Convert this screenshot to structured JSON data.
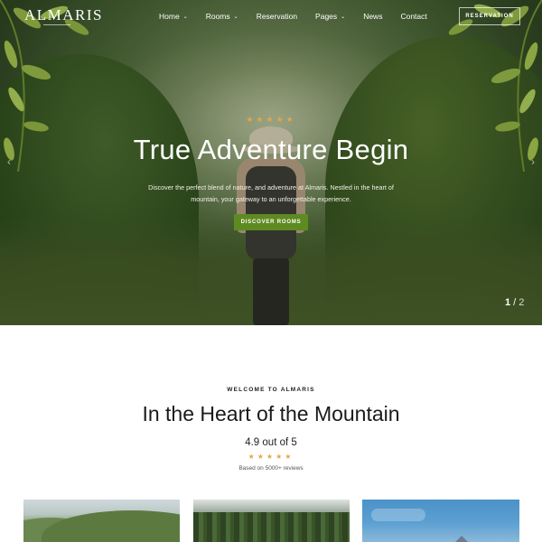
{
  "brand": {
    "name": "ALMARIS"
  },
  "nav": {
    "items": [
      {
        "label": "Home",
        "has_dropdown": true
      },
      {
        "label": "Rooms",
        "has_dropdown": true
      },
      {
        "label": "Reservation",
        "has_dropdown": false
      },
      {
        "label": "Pages",
        "has_dropdown": true
      },
      {
        "label": "News",
        "has_dropdown": false
      },
      {
        "label": "Contact",
        "has_dropdown": false
      }
    ],
    "reserve_label": "RESERVATION"
  },
  "hero": {
    "stars": "★★★★★",
    "title": "True Adventure Begin",
    "description": "Discover the perfect blend of nature, and adventure at Almaris. Nestled in the heart of mountain, your gateway to an unforgettable experience.",
    "button_label": "DISCOVER ROOMS",
    "slide_current": "1",
    "slide_separator": "/",
    "slide_total": "2"
  },
  "welcome": {
    "eyebrow": "WELCOME TO ALMARIS",
    "title": "In the Heart of the Mountain",
    "rating_text": "4.9 out of 5",
    "stars": "★★★★★",
    "reviews_text": "Based on 5000+ reviews"
  },
  "colors": {
    "accent_green": "#5e8a22",
    "star_gold": "#e3a64a"
  }
}
